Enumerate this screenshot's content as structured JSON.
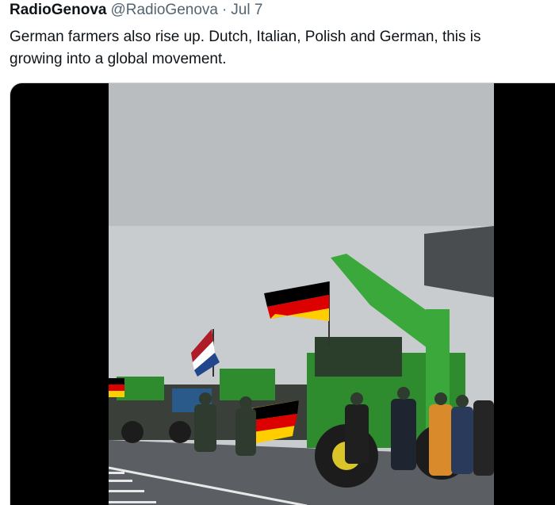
{
  "tweet": {
    "display_name": "RadioGenova",
    "handle": "@RadioGenova",
    "separator": "·",
    "timestamp": "Jul 7",
    "text_lines": [
      "German farmers also rise up. Dutch, Italian, Polish and German, this is",
      "growing into a global movement."
    ]
  },
  "media": {
    "type": "video",
    "letterbox_color": "#000000",
    "sky_color": "#c9cccf",
    "road_color": "#5b5e62",
    "tractor_green": "#2e8b2e",
    "flag_colors": [
      "#000000",
      "#dd0000",
      "#ffce00"
    ],
    "dutch_flag_colors": [
      "#ae1c28",
      "#ffffff",
      "#21468b"
    ]
  }
}
